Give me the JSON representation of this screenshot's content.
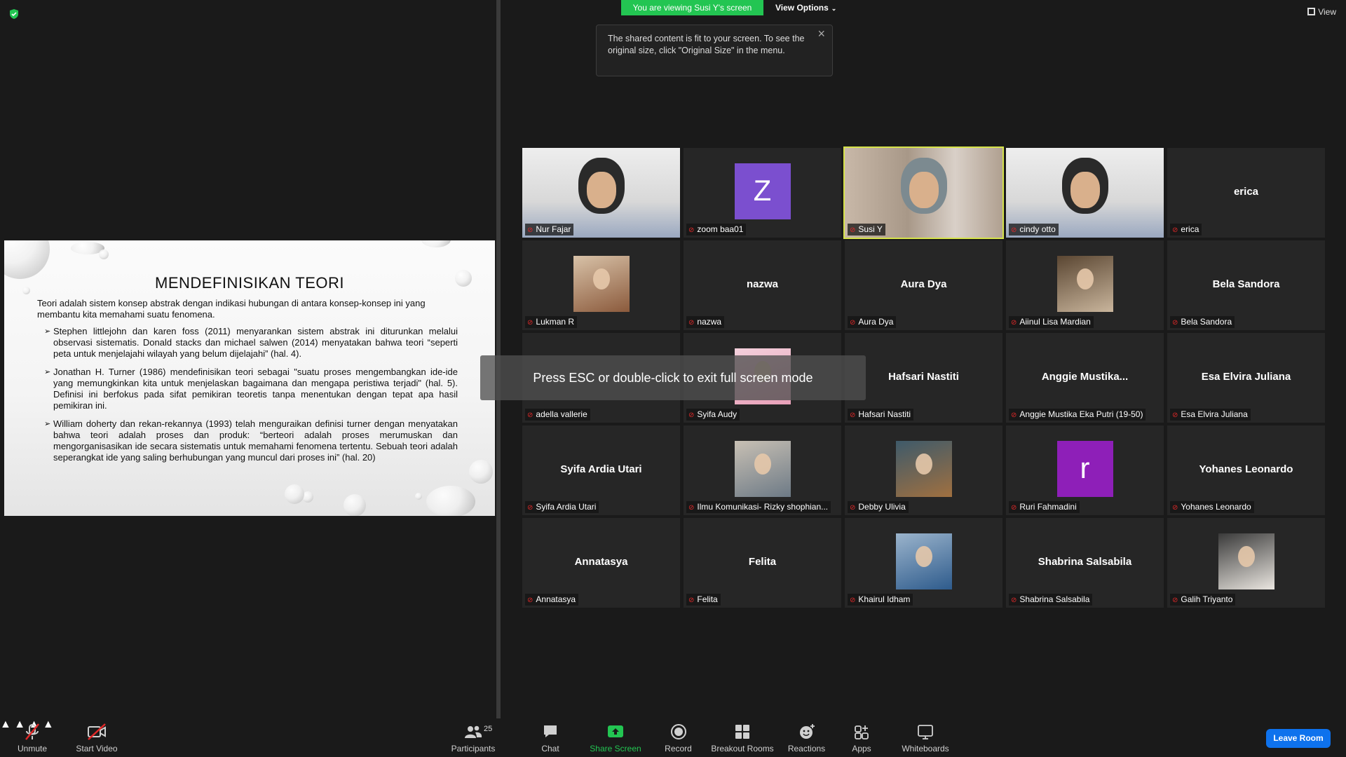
{
  "banner": {
    "viewing_text": "You are viewing Susi Y's screen",
    "view_options_label": "View Options",
    "tooltip_text": "The shared content is fit to your screen. To see the original size, click \"Original Size\" in the menu.",
    "view_button_label": "View"
  },
  "slide": {
    "title": "MENDEFINISIKAN TEORI",
    "intro": "Teori adalah sistem konsep abstrak dengan indikasi hubungan di antara konsep-konsep ini yang membantu kita memahami suatu fenomena.",
    "bullets": [
      "Stephen littlejohn dan karen foss (2011) menyarankan sistem abstrak ini diturunkan melalui observasi sistematis. Donald stacks dan michael salwen (2014) menyatakan bahwa teori “seperti peta untuk menjelajahi wilayah yang belum dijelajahi” (hal. 4).",
      "Jonathan H. Turner (1986) mendefinisikan teori sebagai \"suatu proses mengembangkan ide-ide yang memungkinkan kita untuk menjelaskan bagaimana dan mengapa peristiwa terjadi\" (hal. 5). Definisi ini berfokus pada sifat pemikiran teoretis tanpa menentukan dengan tepat apa hasil pemikiran ini.",
      "William doherty dan rekan-rekannya (1993) telah menguraikan definisi turner dengan menyatakan bahwa teori adalah proses dan produk: “berteori adalah proses merumuskan dan mengorganisasikan ide secara sistematis untuk memahami fenomena tertentu. Sebuah teori adalah seperangkat ide yang saling berhubungan yang muncul dari proses ini” (hal. 20)"
    ]
  },
  "esc_message": "Press ESC or double-click to exit full screen mode",
  "participants": [
    {
      "name": "Nur Fajar",
      "display": "",
      "type": "video"
    },
    {
      "name": "zoom baa01",
      "display": "Z",
      "type": "letter",
      "color": "#7b4fcf"
    },
    {
      "name": "Susi Y",
      "display": "",
      "type": "video",
      "active": true
    },
    {
      "name": "cindy otto",
      "display": "",
      "type": "video"
    },
    {
      "name": "erica",
      "display": "erica",
      "type": "name"
    },
    {
      "name": "Lukman R",
      "display": "",
      "type": "photo"
    },
    {
      "name": "nazwa",
      "display": "nazwa",
      "type": "name"
    },
    {
      "name": "Aura Dya",
      "display": "Aura Dya",
      "type": "name"
    },
    {
      "name": "Aiinul Lisa Mardian",
      "display": "",
      "type": "photo"
    },
    {
      "name": "Bela Sandora",
      "display": "Bela Sandora",
      "type": "name"
    },
    {
      "name": "adella vallerie",
      "display": "",
      "type": "name"
    },
    {
      "name": "Syifa Audy",
      "display": "",
      "type": "photo"
    },
    {
      "name": "Hafsari Nastiti",
      "display": "Hafsari Nastiti",
      "type": "name"
    },
    {
      "name": "Anggie Mustika Eka Putri (19-50)",
      "display": "Anggie  Mustika...",
      "type": "name"
    },
    {
      "name": "Esa Elvira Juliana",
      "display": "Esa Elvira Juliana",
      "type": "name"
    },
    {
      "name": "Syifa Ardia Utari",
      "display": "Syifa Ardia Utari",
      "type": "name"
    },
    {
      "name": "Ilmu Komunikasi- Rizky shophian...",
      "display": "",
      "type": "photo"
    },
    {
      "name": "Debby Ulivia",
      "display": "",
      "type": "photo"
    },
    {
      "name": "Ruri Fahmadini",
      "display": "r",
      "type": "letter",
      "color": "#8e1fb8"
    },
    {
      "name": "Yohanes Leonardo",
      "display": "Yohanes Leonardo",
      "type": "name"
    },
    {
      "name": "Annatasya",
      "display": "Annatasya",
      "type": "name"
    },
    {
      "name": "Felita",
      "display": "Felita",
      "type": "name"
    },
    {
      "name": "Khairul Idham",
      "display": "",
      "type": "photo"
    },
    {
      "name": "Shabrina Salsabila",
      "display": "Shabrina Salsabila",
      "type": "name"
    },
    {
      "name": "Galih Triyanto",
      "display": "",
      "type": "photo"
    }
  ],
  "toolbar": {
    "unmute": "Unmute",
    "start_video": "Start Video",
    "participants": "Participants",
    "participants_count": "25",
    "chat": "Chat",
    "share_screen": "Share Screen",
    "record": "Record",
    "breakout_rooms": "Breakout Rooms",
    "reactions": "Reactions",
    "apps": "Apps",
    "whiteboards": "Whiteboards",
    "leave_room": "Leave Room"
  },
  "colors": {
    "green": "#23c552",
    "leave_blue": "#0e72ed",
    "active_speaker": "#d6e34a"
  }
}
